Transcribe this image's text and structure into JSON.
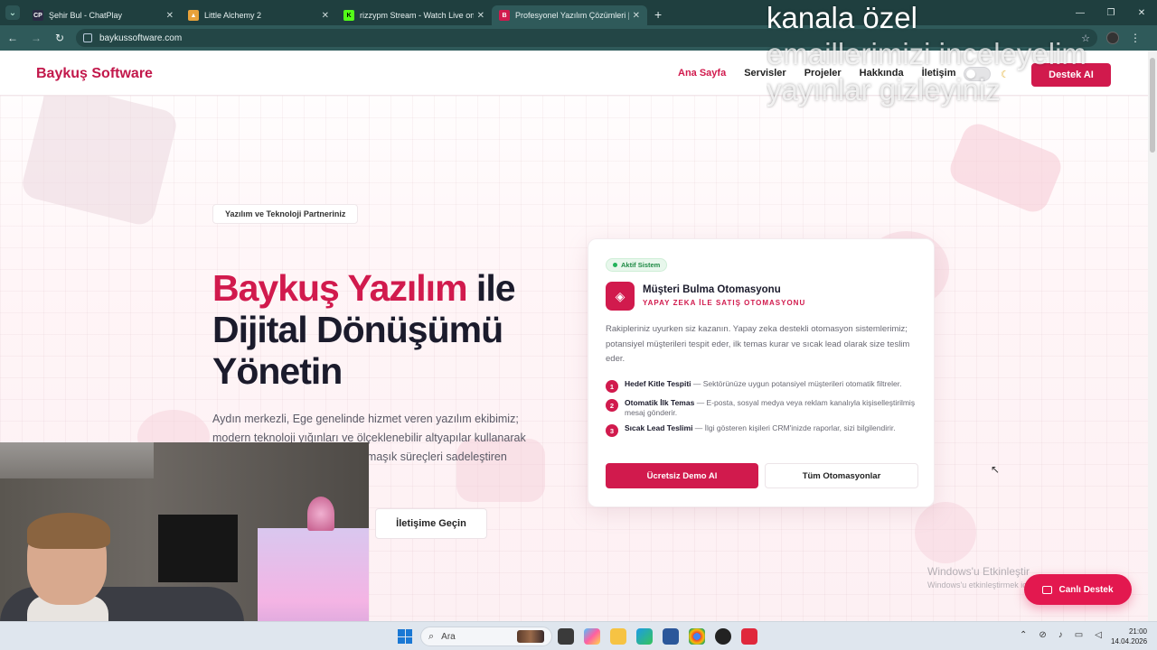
{
  "browser": {
    "tabs": [
      {
        "label": "Şehir Bul - ChatPlay",
        "favicon": "CP",
        "active": false
      },
      {
        "label": "Little Alchemy 2",
        "favicon": "LA",
        "active": false
      },
      {
        "label": "rizzypm Stream - Watch Live on",
        "favicon": "K",
        "active": false
      },
      {
        "label": "Profesyonel Yazılım Çözümleri |",
        "favicon": "B",
        "active": true
      }
    ],
    "url": "baykussoftware.com"
  },
  "site": {
    "logo": "Baykuş Software",
    "nav": [
      "Ana Sayfa",
      "Servisler",
      "Projeler",
      "Hakkında",
      "İletişim"
    ],
    "nav_active": "Ana Sayfa",
    "cta": "Destek AI"
  },
  "hero": {
    "badge": "Yazılım ve Teknoloji Partneriniz",
    "title_brand": "Baykuş Yazılım",
    "title_rest_1": " ile",
    "title_line_2": "Dijital Dönüşümü",
    "title_line_3": "Yönetin",
    "description": "Aydın merkezli, Ege genelinde hizmet veren yazılım ekibimiz; modern teknoloji yığınları ve ölçeklenebilir altyapılar kullanarak işletmeniz için değer üretir. Karmaşık süreçleri sadeleştiren çözümler yaratıyoruz.",
    "contact_button": "İletişime Geçin"
  },
  "card": {
    "status": "Aktif Sistem",
    "title": "Müşteri Bulma Otomasyonu",
    "subtitle": "YAPAY ZEKA İLE SATIŞ OTOMASYONU",
    "description": "Rakipleriniz uyurken siz kazanın. Yapay zeka destekli otomasyon sistemlerimiz; potansiyel müşterileri tespit eder, ilk temas kurar ve sıcak lead olarak size teslim eder.",
    "steps": [
      {
        "num": "1",
        "title": "Hedef Kitle Tespiti",
        "text": " — Sektörünüze uygun potansiyel müşterileri otomatik filtreler."
      },
      {
        "num": "2",
        "title": "Otomatik İlk Temas",
        "text": " — E-posta, sosyal medya veya reklam kanalıyla kişiselleştirilmiş mesaj gönderir."
      },
      {
        "num": "3",
        "title": "Sıcak Lead Teslimi",
        "text": " — İlgi gösteren kişileri CRM'inizde raporlar, sizi bilgilendirir."
      }
    ],
    "primary_button": "Ücretsiz Demo Al",
    "secondary_button": "Tüm Otomasyonlar"
  },
  "watermark": {
    "line1": "Windows'u Etkinleştir",
    "line2": "Windows'u etkinleştirmek için Ayarlar'a gidin."
  },
  "live_support": "Canlı Destek",
  "overlay": {
    "line1": "kanala özel",
    "line2": "emaillerimizi inceleyelim",
    "line3": "yayınlar gizleyiniz"
  },
  "taskbar": {
    "search_placeholder": "Ara",
    "time": "21:00",
    "date": "14.04.2026"
  },
  "colors": {
    "brand": "#d11a4d",
    "chrome_dark": "#1f3f3f",
    "chrome_bar": "#2f5a5a"
  }
}
